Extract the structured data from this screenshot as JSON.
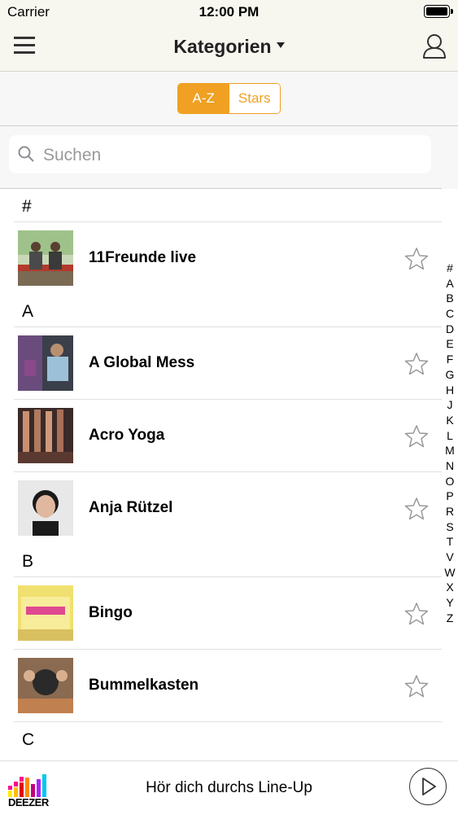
{
  "status": {
    "carrier": "Carrier",
    "time": "12:00 PM"
  },
  "nav": {
    "title": "Kategorien"
  },
  "segments": {
    "az": "A-Z",
    "stars": "Stars",
    "selected": "A-Z"
  },
  "search": {
    "placeholder": "Suchen",
    "value": ""
  },
  "sections": [
    {
      "letter": "#",
      "items": [
        {
          "title": "11Freunde live",
          "starred": false
        }
      ]
    },
    {
      "letter": "A",
      "items": [
        {
          "title": "A Global Mess",
          "starred": false
        },
        {
          "title": "Acro Yoga",
          "starred": false
        },
        {
          "title": "Anja Rützel",
          "starred": false
        }
      ]
    },
    {
      "letter": "B",
      "items": [
        {
          "title": "Bingo",
          "starred": false
        },
        {
          "title": "Bummelkasten",
          "starred": false
        }
      ]
    },
    {
      "letter": "C",
      "items": []
    }
  ],
  "index_letters": [
    "#",
    "A",
    "B",
    "C",
    "D",
    "E",
    "F",
    "G",
    "H",
    "J",
    "K",
    "L",
    "M",
    "N",
    "O",
    "P",
    "R",
    "S",
    "T",
    "V",
    "W",
    "X",
    "Y",
    "Z"
  ],
  "player": {
    "text": "Hör dich durchs Line-Up",
    "brand": "DEEZER"
  },
  "colors": {
    "accent": "#f0a023",
    "navbar_bg": "#f8f7ef"
  },
  "icons": [
    "menu-icon",
    "profile-icon",
    "search-icon",
    "star-icon",
    "play-icon",
    "deezer-logo"
  ]
}
